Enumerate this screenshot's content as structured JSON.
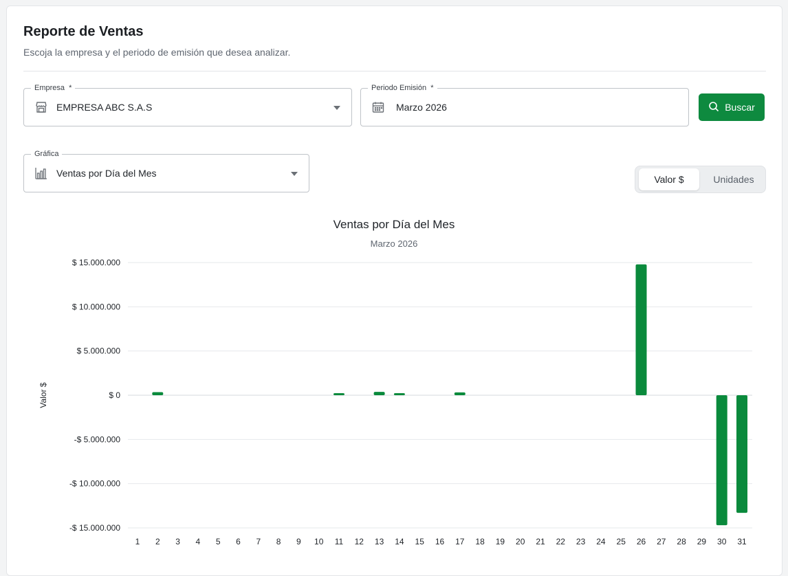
{
  "header": {
    "title": "Reporte de Ventas",
    "subtitle": "Escoja la empresa y el periodo de emisión que desea analizar."
  },
  "filters": {
    "empresa": {
      "label": "Empresa",
      "required_mark": "*",
      "value": "EMPRESA ABC S.A.S",
      "icon": "store-icon"
    },
    "periodo": {
      "label": "Periodo Emisión",
      "required_mark": "*",
      "value": "Marzo 2026",
      "icon": "calendar-icon"
    },
    "buscar_label": "Buscar",
    "grafica": {
      "label": "Gráfica",
      "value": "Ventas por Día del Mes",
      "icon": "bar-chart-icon"
    }
  },
  "toggle": {
    "options": [
      "Valor $",
      "Unidades"
    ],
    "active": "Valor $"
  },
  "colors": {
    "accent": "#0e8a3f",
    "bar": "#0a8a3c"
  },
  "chart_data": {
    "type": "bar",
    "title": "Ventas por Día del Mes",
    "subtitle": "Marzo 2026",
    "xlabel": "",
    "ylabel": "Valor $",
    "ylim": [
      -15000000,
      15000000
    ],
    "yticks": [
      15000000,
      10000000,
      5000000,
      0,
      -5000000,
      -10000000,
      -15000000
    ],
    "ytick_labels": [
      "$ 15.000.000",
      "$ 10.000.000",
      "$ 5.000.000",
      "$ 0",
      "-$ 5.000.000",
      "-$ 10.000.000",
      "-$ 15.000.000"
    ],
    "grid": true,
    "categories": [
      "1",
      "2",
      "3",
      "4",
      "5",
      "6",
      "7",
      "8",
      "9",
      "10",
      "11",
      "12",
      "13",
      "14",
      "15",
      "16",
      "17",
      "18",
      "19",
      "20",
      "21",
      "22",
      "23",
      "24",
      "25",
      "26",
      "27",
      "28",
      "29",
      "30",
      "31"
    ],
    "values": [
      0,
      350000,
      0,
      0,
      0,
      0,
      0,
      0,
      0,
      0,
      230000,
      0,
      380000,
      130000,
      0,
      0,
      320000,
      0,
      0,
      0,
      0,
      0,
      0,
      0,
      0,
      14800000,
      0,
      0,
      0,
      -14700000,
      -13300000
    ]
  }
}
